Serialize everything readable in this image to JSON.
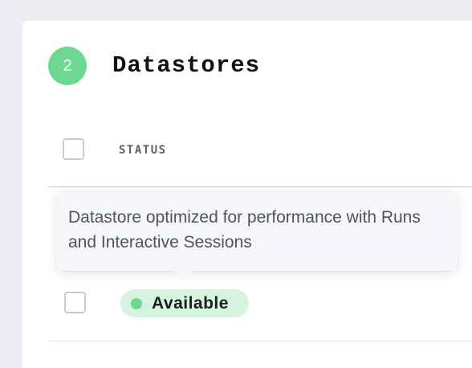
{
  "colors": {
    "accent": "#6dd891",
    "badge_background": "#d6f3de",
    "page_background": "#eceef2",
    "tooltip_background": "#f5f6fa"
  },
  "section": {
    "step_number": "2",
    "title": "Datastores"
  },
  "table": {
    "columns": [
      "STATUS"
    ],
    "rows": [
      {
        "status": "Available",
        "status_color": "#6dd891"
      }
    ]
  },
  "tooltip": {
    "text": "Datastore optimized for performance with Runs and Interactive Sessions"
  }
}
